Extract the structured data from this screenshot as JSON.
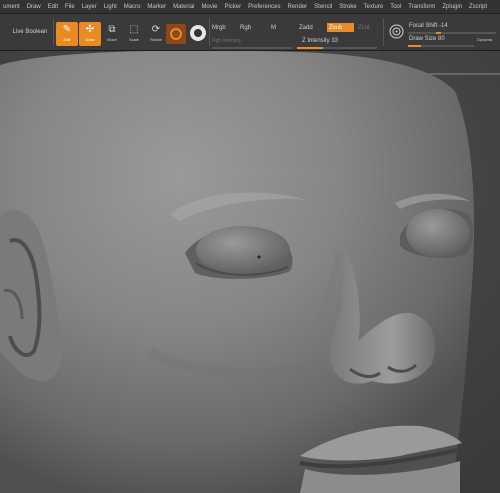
{
  "menubar": {
    "items": [
      "ument",
      "Draw",
      "Edit",
      "File",
      "Layer",
      "Light",
      "Macro",
      "Marker",
      "Material",
      "Movie",
      "Picker",
      "Preferences",
      "Render",
      "Stencil",
      "Stroke",
      "Texture",
      "Tool",
      "Transform",
      "Zplugin",
      "Zscript"
    ]
  },
  "toolbar": {
    "live_boolean": "Live Boolean",
    "edit_label": "Edit",
    "draw_label": "Draw",
    "move_label": "Move",
    "scale_label": "Scale",
    "rotate_label": "Rotate",
    "mrgb_label": "Mrgb",
    "rgb_label": "Rgb",
    "m_label": "M",
    "rgb_intensity_label": "Rgb Intensity",
    "zadd_label": "Zadd",
    "zsub_label": "Zsub",
    "zcut_label": "Zcut",
    "z_intensity_label": "Z Intensity 33",
    "focal_shift_label": "Focal Shift -14",
    "draw_size_label": "Draw Size 80",
    "dynamic_label": "Dynamic"
  },
  "sliders": {
    "z_intensity_fraction": 0.33,
    "draw_size_fraction": 0.2
  },
  "colors": {
    "accent": "#e98a24",
    "menubar_bg": "#333333",
    "toolbar_bg": "#3a3a3a"
  }
}
